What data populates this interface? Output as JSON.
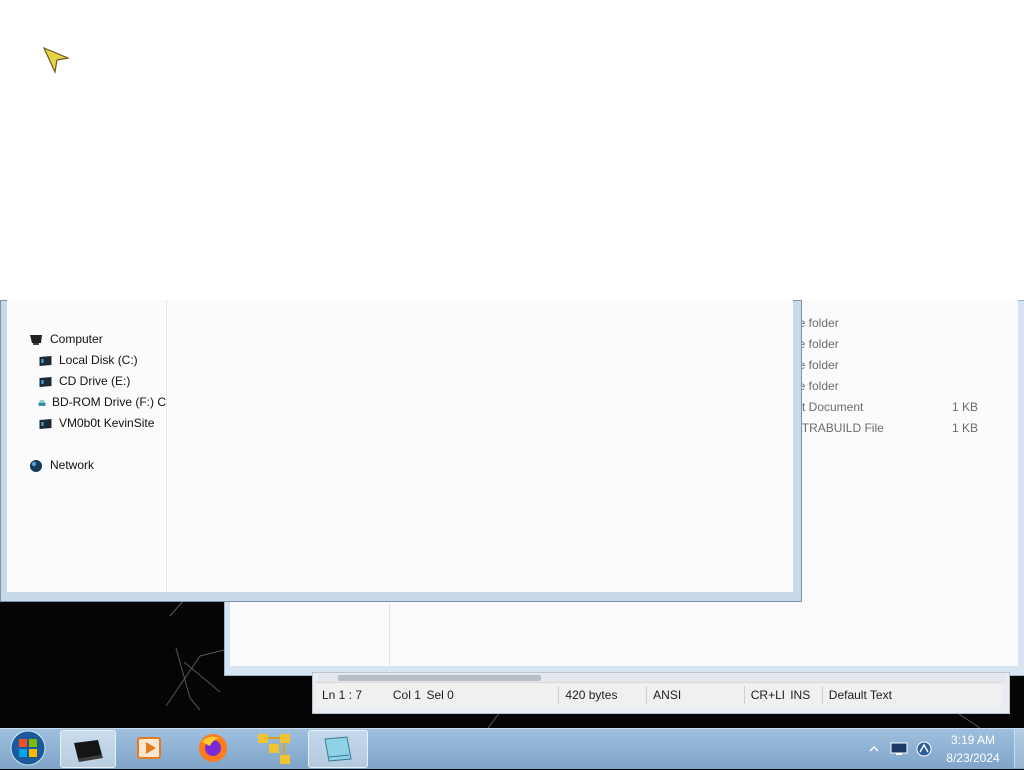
{
  "navigation": {
    "computer": "Computer",
    "drives": [
      {
        "label": "Local Disk (C:)",
        "icon": "hard-drive-icon"
      },
      {
        "label": "CD Drive (E:)",
        "icon": "cd-drive-icon"
      },
      {
        "label": "BD-ROM Drive (F:) C",
        "icon": "bd-rom-drive-icon"
      },
      {
        "label": "VM0b0t KevinSite",
        "icon": "network-drive-icon"
      }
    ],
    "network": "Network"
  },
  "back_window": {
    "files": [
      {
        "type": "le folder",
        "size": ""
      },
      {
        "type": "le folder",
        "size": ""
      },
      {
        "type": "le folder",
        "size": ""
      },
      {
        "type": "le folder",
        "size": ""
      },
      {
        "type": "xt Document",
        "size": "1 KB"
      },
      {
        "type": "LTRABUILD File",
        "size": "1 KB"
      }
    ]
  },
  "editor_status": {
    "position": "Ln 1 : 7",
    "column": "Col 1",
    "selection": "Sel 0",
    "size": "420 bytes",
    "encoding": "ANSI",
    "line_endings": "CR+LF",
    "mode": "INS",
    "language": "Default Text"
  },
  "taskbar": {
    "apps": [
      "start-orb-icon",
      "terminal-icon",
      "media-player-icon",
      "firefox-icon",
      "network-tool-icon",
      "notepad-icon"
    ],
    "tray_icons": [
      "show-hidden-icons-chevron",
      "monitor-icon",
      "network-status-icon"
    ],
    "time": "3:19 AM",
    "date": "8/23/2024"
  },
  "colors": {
    "taskbar": "#8fb2d4",
    "window_frame": "#c8d9ec",
    "accent": "#1e6fbf"
  }
}
